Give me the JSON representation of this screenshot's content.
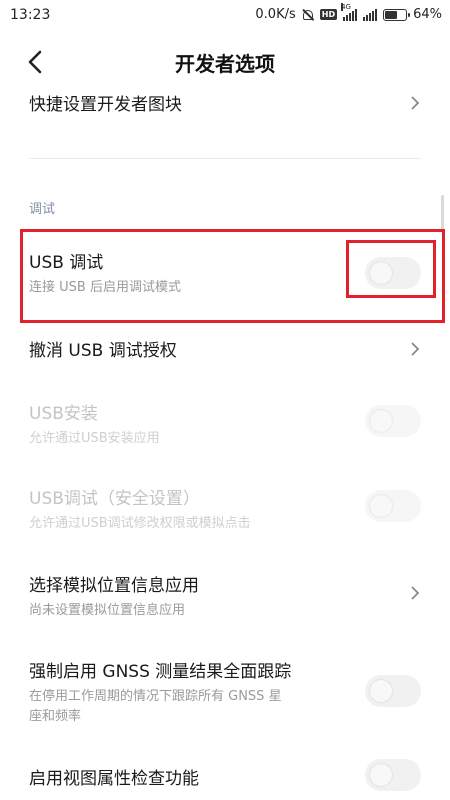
{
  "status_bar": {
    "time": "13:23",
    "speed": "0.0K/s",
    "hd": "HD",
    "network_type": "4G",
    "battery_percent": "64%",
    "battery_level": 0.64,
    "icons": [
      "mute-bell-icon",
      "hd-icon",
      "signal-icon",
      "signal-icon",
      "battery-icon"
    ]
  },
  "header": {
    "title": "开发者选项",
    "back_icon": "back-arrow-icon"
  },
  "items": {
    "quick_tiles": {
      "title": "快捷设置开发者图块"
    },
    "debug_section": {
      "label": "调试"
    },
    "usb_debug": {
      "title": "USB 调试",
      "subtitle": "连接 USB 后启用调试模式",
      "enabled": false
    },
    "revoke_usb": {
      "title": "撤消 USB 调试授权"
    },
    "usb_install": {
      "title": "USB安装",
      "subtitle": "允许通过USB安装应用",
      "enabled": false
    },
    "usb_debug_secure": {
      "title": "USB调试（安全设置）",
      "subtitle": "允许通过USB调试修改权限或模拟点击",
      "enabled": false
    },
    "mock_location": {
      "title": "选择模拟位置信息应用",
      "subtitle": "尚未设置模拟位置信息应用"
    },
    "gnss": {
      "title": "强制启用 GNSS 测量结果全面跟踪",
      "subtitle_line1": "在停用工作周期的情况下跟踪所有 GNSS 星",
      "subtitle_line2": "座和频率",
      "enabled": false
    },
    "view_attr": {
      "title": "启用视图属性检查功能",
      "enabled": false
    }
  },
  "colors": {
    "highlight": "#e0222c",
    "section_label": "#7f8fa8",
    "subtitle": "#9a9a9a",
    "toggle_off": "#f1f1f1"
  }
}
